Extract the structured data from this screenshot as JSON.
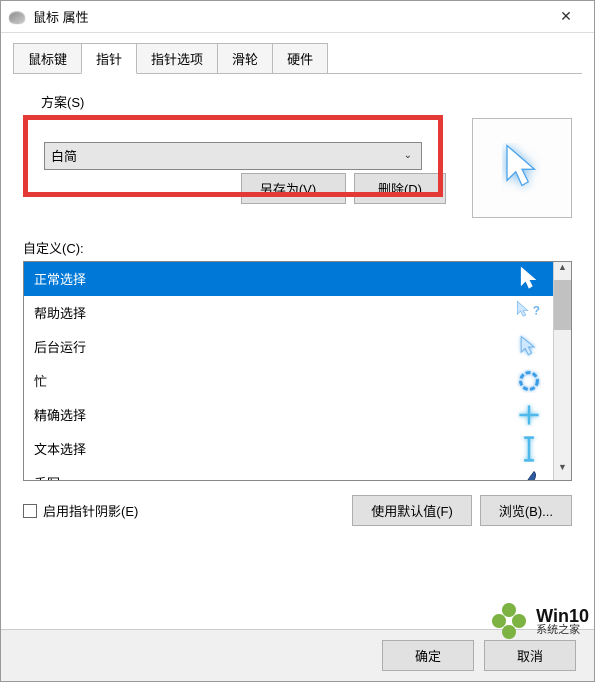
{
  "window": {
    "title": "鼠标 属性"
  },
  "tabs": [
    {
      "label": "鼠标键",
      "active": false
    },
    {
      "label": "指针",
      "active": true
    },
    {
      "label": "指针选项",
      "active": false
    },
    {
      "label": "滑轮",
      "active": false
    },
    {
      "label": "硬件",
      "active": false
    }
  ],
  "scheme": {
    "label": "方案(S)",
    "value": "白简",
    "save_as": "另存为(V)...",
    "delete": "删除(D)"
  },
  "customize": {
    "label": "自定义(C):",
    "items": [
      {
        "label": "正常选择",
        "icon": "arrow",
        "selected": true
      },
      {
        "label": "帮助选择",
        "icon": "help",
        "selected": false
      },
      {
        "label": "后台运行",
        "icon": "busy-arrow",
        "selected": false
      },
      {
        "label": "忙",
        "icon": "busy",
        "selected": false
      },
      {
        "label": "精确选择",
        "icon": "cross",
        "selected": false
      },
      {
        "label": "文本选择",
        "icon": "ibeam",
        "selected": false
      },
      {
        "label": "手写",
        "icon": "pen",
        "selected": false
      }
    ]
  },
  "shadow_checkbox": "启用指针阴影(E)",
  "buttons": {
    "use_default": "使用默认值(F)",
    "browse": "浏览(B)...",
    "ok": "确定",
    "cancel": "取消"
  },
  "watermark": {
    "brand": "Win10",
    "site": "系统之家"
  }
}
